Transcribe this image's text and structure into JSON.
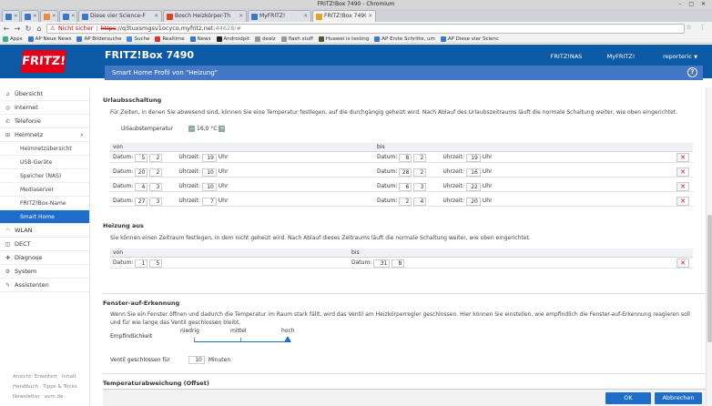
{
  "window": {
    "title": "FRITZ!Box 7490 - Chromium"
  },
  "tabs": [
    {
      "label": "",
      "color": "#3c78c8"
    },
    {
      "label": "",
      "color": "#3c78c8"
    },
    {
      "label": "",
      "color": "#e84"
    },
    {
      "label": "",
      "color": "#3c78c8"
    },
    {
      "label": "Diese vier Science-F",
      "color": "#3c78c8"
    },
    {
      "label": "Bosch Heizkörper-Th",
      "color": "#d42"
    },
    {
      "label": "MyFRITZ!",
      "color": "#3c78c8"
    },
    {
      "label": "FRITZ!Box 7490",
      "color": "#e8a020",
      "active": true
    }
  ],
  "address": {
    "warning": "Nicht sicher",
    "protocol": "https",
    "host": "://q3tuxsmgsv1ocyco.myfritz.net",
    "rest": ":44628/#"
  },
  "bookmarks": [
    {
      "label": "Apps",
      "color": "#4a8"
    },
    {
      "label": "AP Neue News",
      "color": "#3c78c8"
    },
    {
      "label": "AP Bildersuche",
      "color": "#3c78c8"
    },
    {
      "label": "Suche",
      "color": "#4285f4"
    },
    {
      "label": "Realtime",
      "color": "#d33"
    },
    {
      "label": "News",
      "color": "#3c78c8"
    },
    {
      "label": "Androidpit",
      "color": "#222"
    },
    {
      "label": "dealz",
      "color": "#999"
    },
    {
      "label": "flash stuff",
      "color": "#999"
    },
    {
      "label": "Huawei is testing",
      "color": "#553"
    },
    {
      "label": "AP Erste Schritte, um",
      "color": "#3c78c8"
    },
    {
      "label": "AP Diese vier Scienc",
      "color": "#3c78c8"
    }
  ],
  "header": {
    "logo": "FRITZ!",
    "product": "FRITZ!Box 7490",
    "links": {
      "nas": "FRITZ!NAS",
      "myfritz": "MyFRITZ!",
      "user": "reporteric"
    },
    "subtitle": "Smart Home Profil von \"Heizung\"",
    "help": "?"
  },
  "sidebar": {
    "items": [
      {
        "label": "Übersicht",
        "icon": "home-icon"
      },
      {
        "label": "Internet",
        "icon": "globe-icon"
      },
      {
        "label": "Telefonie",
        "icon": "phone-icon"
      },
      {
        "label": "Heimnetz",
        "icon": "network-icon"
      }
    ],
    "subitems": [
      "Heimnetzübersicht",
      "USB-Geräte",
      "Speicher (NAS)",
      "Mediaserver",
      "FRITZ!Box-Name",
      "Smart Home"
    ],
    "lower": [
      {
        "label": "WLAN",
        "icon": "wifi-icon"
      },
      {
        "label": "DECT",
        "icon": "dect-icon"
      },
      {
        "label": "Diagnose",
        "icon": "diagnose-icon"
      },
      {
        "label": "System",
        "icon": "system-icon"
      },
      {
        "label": "Assistenten",
        "icon": "wizard-icon"
      }
    ],
    "footer": [
      "Ansicht: Erweitert",
      "Inhalt",
      "Handbuch",
      "Tipps & Tricks",
      "Newsletter",
      "avm.de"
    ]
  },
  "urlaub": {
    "title": "Urlaubsschaltung",
    "desc": "Für Zeiten, in denen Sie abwesend sind, können Sie eine Temperatur festlegen, auf die durchgängig geheizt wird. Nach Ablauf des Urlaubszeitraums läuft die normale Schaltung weiter, wie oben eingerichtet.",
    "temp_label": "Urlaubstemperatur",
    "temp_value": "16,0 °C",
    "col_von": "von",
    "col_bis": "bis",
    "datum": "Datum:",
    "uhrzeit": "Uhrzeit:",
    "uhr": "Uhr",
    "rows": [
      {
        "von_d": "5",
        "von_m": "2",
        "von_h": "19",
        "bis_d": "8",
        "bis_m": "2",
        "bis_h": "19"
      },
      {
        "von_d": "20",
        "von_m": "2",
        "von_h": "10",
        "bis_d": "28",
        "bis_m": "2",
        "bis_h": "16"
      },
      {
        "von_d": "4",
        "von_m": "3",
        "von_h": "10",
        "bis_d": "6",
        "bis_m": "3",
        "bis_h": "22"
      },
      {
        "von_d": "27",
        "von_m": "3",
        "von_h": "7",
        "bis_d": "2",
        "bis_m": "4",
        "bis_h": "20"
      }
    ]
  },
  "heizung_aus": {
    "title": "Heizung aus",
    "desc": "Sie können einen Zeitraum festlegen, in dem nicht geheizt wird. Nach Ablauf dieses Zeitraums läuft die normale Schaltung weiter, wie oben eingerichtet.",
    "col_von": "von",
    "col_bis": "bis",
    "von_d": "1",
    "von_m": "5",
    "bis_d": "31",
    "bis_m": "8"
  },
  "fenster": {
    "title": "Fenster-auf-Erkennung",
    "desc": "Wenn Sie ein Fenster öffnen und dadurch die Temperatur im Raum stark fällt, wird das Ventil am Heizkörperregler geschlossen. Hier können Sie einstellen, wie empfindlich die Fenster-auf-Erkennung reagieren soll und für wie lange das Ventil geschlossen bleibt.",
    "sens_label": "Empfindlichkeit",
    "levels": [
      "niedrig",
      "mittel",
      "hoch"
    ],
    "sensitivity": 1.0,
    "closed_label": "Ventil geschlossen für",
    "closed_value": "10",
    "closed_unit": "Minuten"
  },
  "temp_abw": {
    "title": "Temperaturabweichung (Offset)"
  },
  "buttons": {
    "ok": "OK",
    "cancel": "Abbrechen"
  },
  "delete_symbol": "✕"
}
